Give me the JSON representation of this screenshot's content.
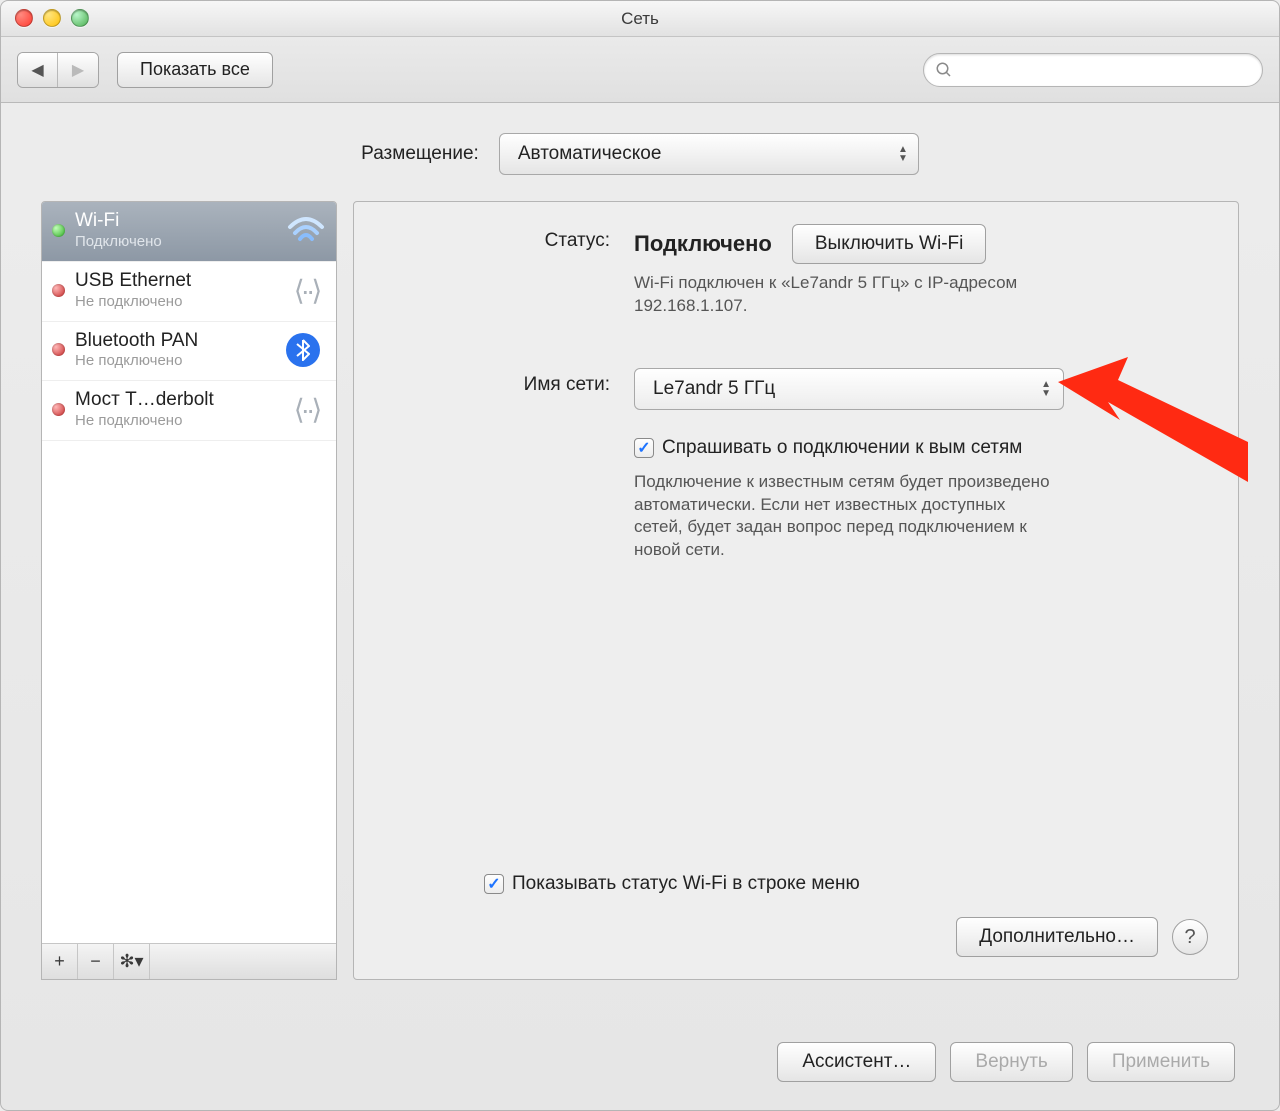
{
  "window": {
    "title": "Сеть"
  },
  "toolbar": {
    "show_all_label": "Показать все",
    "search_placeholder": ""
  },
  "location": {
    "label": "Размещение:",
    "value": "Автоматическое"
  },
  "sidebar": {
    "items": [
      {
        "name": "Wi-Fi",
        "status": "Подключено",
        "dot": "green",
        "icon": "wifi",
        "selected": true
      },
      {
        "name": "USB Ethernet",
        "status": "Не подключено",
        "dot": "red",
        "icon": "ethernet",
        "selected": false
      },
      {
        "name": "Bluetooth PAN",
        "status": "Не подключено",
        "dot": "red",
        "icon": "bluetooth",
        "selected": false
      },
      {
        "name": "Мост T…derbolt",
        "status": "Не подключено",
        "dot": "red",
        "icon": "ethernet",
        "selected": false
      }
    ]
  },
  "detail": {
    "status_label": "Статус:",
    "status_value": "Подключено",
    "toggle_wifi_label": "Выключить Wi-Fi",
    "status_desc": "Wi-Fi подключен к «Le7andr 5 ГГц» с IP-адресом 192.168.1.107.",
    "network_label": "Имя сети:",
    "network_value": "Le7andr 5 ГГц",
    "ask_join_label": "Спрашивать о подключении к       вым сетям",
    "ask_join_desc": "Подключение к известным сетям будет произведено автоматически. Если нет известных доступных сетей, будет задан вопрос перед подключением к новой сети.",
    "show_status_label": "Показывать статус Wi-Fi в строке меню",
    "advanced_label": "Дополнительно…"
  },
  "footer": {
    "assistant_label": "Ассистент…",
    "revert_label": "Вернуть",
    "apply_label": "Применить"
  }
}
